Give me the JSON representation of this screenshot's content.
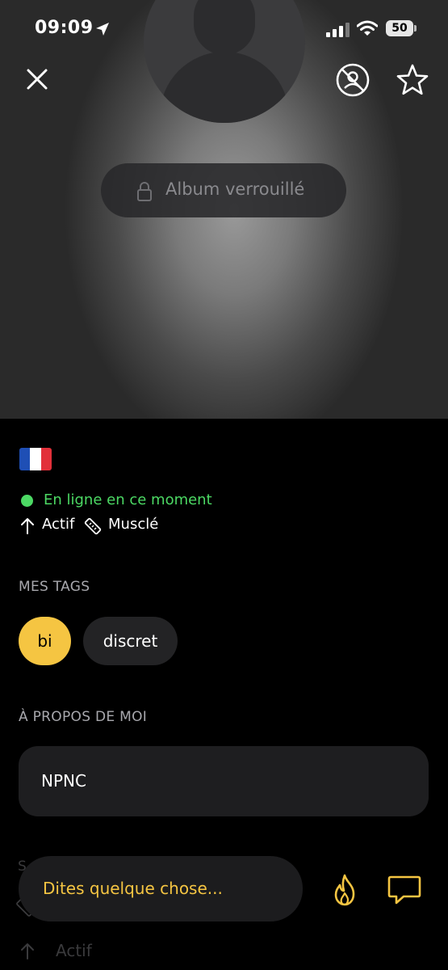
{
  "status_bar": {
    "time": "09:09",
    "battery": "50"
  },
  "header": {
    "close_icon": "close-icon",
    "block_icon": "user-blocked-icon",
    "favorite_icon": "star-icon"
  },
  "album": {
    "label": "Album verrouillé",
    "icon": "lock-icon"
  },
  "profile": {
    "flag": "france-flag",
    "online_status": "En ligne en ce moment",
    "stats": {
      "role": "Actif",
      "body": "Musclé"
    }
  },
  "tags": {
    "title": "MES TAGS",
    "items": [
      "bi",
      "discret"
    ]
  },
  "about": {
    "title": "À PROPOS DE MOI",
    "text": "NPNC"
  },
  "next_section": {
    "partial_label": "S",
    "role": "Actif"
  },
  "composer": {
    "placeholder": "Dites quelque chose..."
  },
  "colors": {
    "accent": "#f5c542",
    "online": "#4cd964",
    "background": "#000000",
    "card": "#1e1e20"
  }
}
